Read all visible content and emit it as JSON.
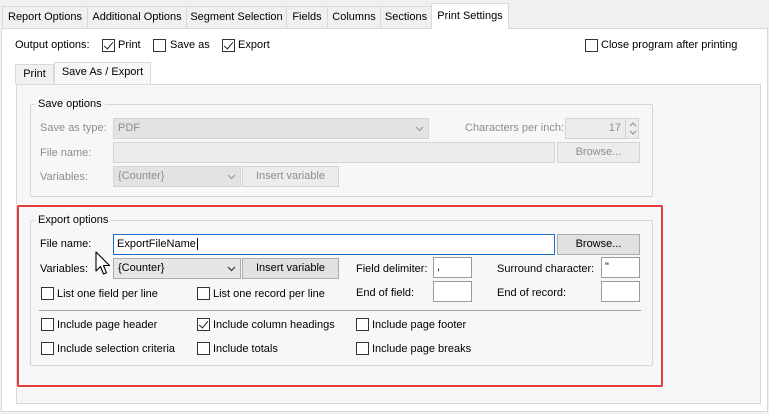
{
  "tabs": [
    "Report Options",
    "Additional Options",
    "Segment Selection",
    "Fields",
    "Columns",
    "Sections",
    "Print Settings"
  ],
  "output_options": {
    "label": "Output options:",
    "print": {
      "label": "Print",
      "checked": true
    },
    "save_as": {
      "label": "Save as",
      "checked": false
    },
    "export": {
      "label": "Export",
      "checked": true
    },
    "close_program": {
      "label": "Close program after printing",
      "checked": false
    }
  },
  "inner_tabs": [
    "Print",
    "Save As / Export"
  ],
  "save_options": {
    "title": "Save options",
    "save_as_type_label": "Save as type:",
    "save_as_type_value": "PDF",
    "chars_per_inch_label": "Characters per inch:",
    "chars_per_inch_value": "17",
    "file_name_label": "File name:",
    "file_name_value": "",
    "browse_label": "Browse...",
    "variables_label": "Variables:",
    "variables_value": "{Counter}",
    "insert_variable_label": "Insert variable"
  },
  "export_options": {
    "title": "Export options",
    "file_name_label": "File name:",
    "file_name_value": "ExportFileName",
    "browse_label": "Browse...",
    "variables_label": "Variables:",
    "variables_value": "{Counter}",
    "insert_variable_label": "Insert variable",
    "field_delimiter_label": "Field delimiter:",
    "field_delimiter_value": ",",
    "surround_character_label": "Surround character:",
    "surround_character_value": "\"",
    "end_of_field_label": "End of field:",
    "end_of_field_value": "",
    "end_of_record_label": "End of record:",
    "end_of_record_value": "",
    "list_one_field_label": "List one field per line",
    "list_one_record_label": "List one record per line",
    "include_page_header": {
      "label": "Include page header",
      "checked": false
    },
    "include_column_headings": {
      "label": "Include column headings",
      "checked": true
    },
    "include_page_footer": {
      "label": "Include page footer",
      "checked": false
    },
    "include_selection_criteria": {
      "label": "Include selection criteria",
      "checked": false
    },
    "include_totals": {
      "label": "Include totals",
      "checked": false
    },
    "include_page_breaks": {
      "label": "Include page breaks",
      "checked": false
    }
  },
  "colors": {
    "highlight": "#e23c3c",
    "focus_border": "#1e6dc9"
  }
}
